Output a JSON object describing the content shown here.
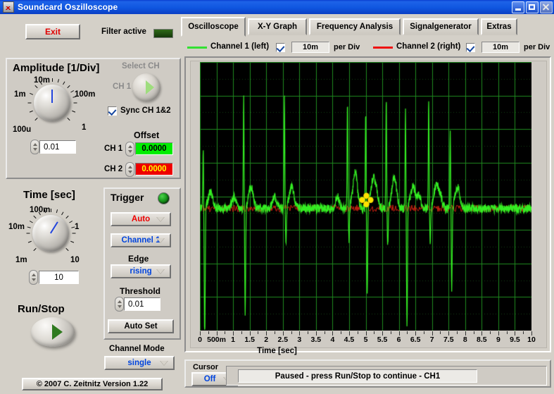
{
  "window": {
    "title": "Soundcard Oszilloscope",
    "icon": "oscilloscope-app-icon",
    "buttons": {
      "minimize": "minimize-icon",
      "maximize": "maximize-icon",
      "close": "close-icon"
    }
  },
  "toolbar": {
    "exit_label": "Exit",
    "filter_label": "Filter active",
    "filter_led_color": "#2f6a18"
  },
  "tabs": [
    {
      "label": "Oscilloscope",
      "active": true
    },
    {
      "label": "X-Y Graph",
      "active": false
    },
    {
      "label": "Frequency Analysis",
      "active": false
    },
    {
      "label": "Signalgenerator",
      "active": false
    },
    {
      "label": "Extras",
      "active": false
    }
  ],
  "channels": [
    {
      "name": "Channel 1 (left)",
      "color": "#33e033",
      "enabled": true,
      "per_div_value": "10m",
      "per_div_label": "per Div"
    },
    {
      "name": "Channel 2 (right)",
      "color": "#ee1111",
      "enabled": true,
      "per_div_value": "10m",
      "per_div_label": "per Div"
    }
  ],
  "amplitude": {
    "title": "Amplitude [1/Div]",
    "knob_captions": [
      "100u",
      "1m",
      "10m",
      "100m",
      "1"
    ],
    "value": "0.01",
    "select_ch_label": "Select CH",
    "select_ch_value": "CH 1",
    "sync_label": "Sync CH 1&2",
    "sync_checked": true,
    "offset_label": "Offset",
    "offset_ch1_label": "CH 1",
    "offset_ch1_value": "0.0000",
    "offset_ch1_color": "#00ee00",
    "offset_ch2_label": "CH 2",
    "offset_ch2_value": "0.0000",
    "offset_ch2_color": "#ee0000"
  },
  "time": {
    "title": "Time [sec]",
    "knob_captions": [
      "1m",
      "10m",
      "100m",
      "1",
      "10"
    ],
    "value": "10"
  },
  "run_stop": {
    "label": "Run/Stop"
  },
  "trigger": {
    "title": "Trigger",
    "led": "trigger-led",
    "mode_value": "Auto",
    "mode_color": "#ee0000",
    "source_value": "Channel 1",
    "source_color": "#0044dd",
    "edge_label": "Edge",
    "edge_value": "rising",
    "edge_color": "#0044dd",
    "threshold_label": "Threshold",
    "threshold_value": "0.01",
    "auto_set_label": "Auto Set"
  },
  "channel_mode": {
    "label": "Channel Mode",
    "value": "single",
    "value_color": "#0044dd"
  },
  "footer": {
    "copyright": "© 2007   C. Zeitnitz Version 1.22"
  },
  "cursor": {
    "label": "Cursor",
    "value": "Off",
    "value_color": "#0044dd"
  },
  "status": {
    "message": "Paused - press Run/Stop to continue - CH1"
  },
  "chart_data": {
    "type": "line",
    "title": "Oscilloscope trace",
    "xlabel": "Time [sec]",
    "ylabel": "",
    "xlim": [
      0,
      10
    ],
    "ylim": [
      -0.05,
      0.05
    ],
    "grid": true,
    "background": "#000000",
    "grid_color": "#1e7a1e",
    "xticks": [
      0,
      0.5,
      1,
      1.5,
      2,
      2.5,
      3,
      3.5,
      4,
      4.5,
      5,
      5.5,
      6,
      6.5,
      7,
      7.5,
      8,
      8.5,
      9,
      9.5,
      10
    ],
    "xticklabels": [
      "0",
      "500m",
      "1",
      "1.5",
      "2",
      "2.5",
      "3",
      "3.5",
      "4",
      "4.5",
      "5",
      "5.5",
      "6",
      "6.5",
      "7",
      "7.5",
      "8",
      "8.5",
      "9",
      "9.5",
      "10"
    ],
    "series": [
      {
        "name": "Channel 1 (left)",
        "color": "#33ee22",
        "description": "ECG-like trace: periodic QRS complexes with sharp positive R spikes and deep negative S deflections on a noisy baseline",
        "baseline_y": 0.0,
        "beats": [
          {
            "t": 0.1,
            "r_amp": 0.022,
            "s_amp": -0.05,
            "t_amp": 0.006
          },
          {
            "t": 1.32,
            "r_amp": 0.041,
            "s_amp": -0.04,
            "t_amp": 0.008
          },
          {
            "t": 2.55,
            "r_amp": 0.041,
            "s_amp": -0.014,
            "t_amp": 0.008
          },
          {
            "t": 4.45,
            "r_amp": 0.04,
            "s_amp": -0.012,
            "t_amp": 0.008
          },
          {
            "t": 5.0,
            "r_amp": 0.036,
            "s_amp": -0.032,
            "t_amp": 0.01
          },
          {
            "t": 5.62,
            "r_amp": 0.042,
            "s_amp": -0.014,
            "t_amp": 0.008
          },
          {
            "t": 6.2,
            "r_amp": 0.036,
            "s_amp": -0.044,
            "t_amp": 0.008
          },
          {
            "t": 6.9,
            "r_amp": 0.041,
            "s_amp": -0.013,
            "t_amp": 0.008
          },
          {
            "t": 7.55,
            "r_amp": 0.03,
            "s_amp": -0.03,
            "t_amp": 0.008
          }
        ]
      },
      {
        "name": "Channel 2 (right)",
        "color": "#cc2211",
        "description": "Flat noisy baseline near zero, mostly hidden under Channel 1",
        "baseline_y": 0.0
      }
    ],
    "cursor_marker": {
      "t": 5.02,
      "color": "#ffe100",
      "shape": "diamond-cluster"
    }
  }
}
